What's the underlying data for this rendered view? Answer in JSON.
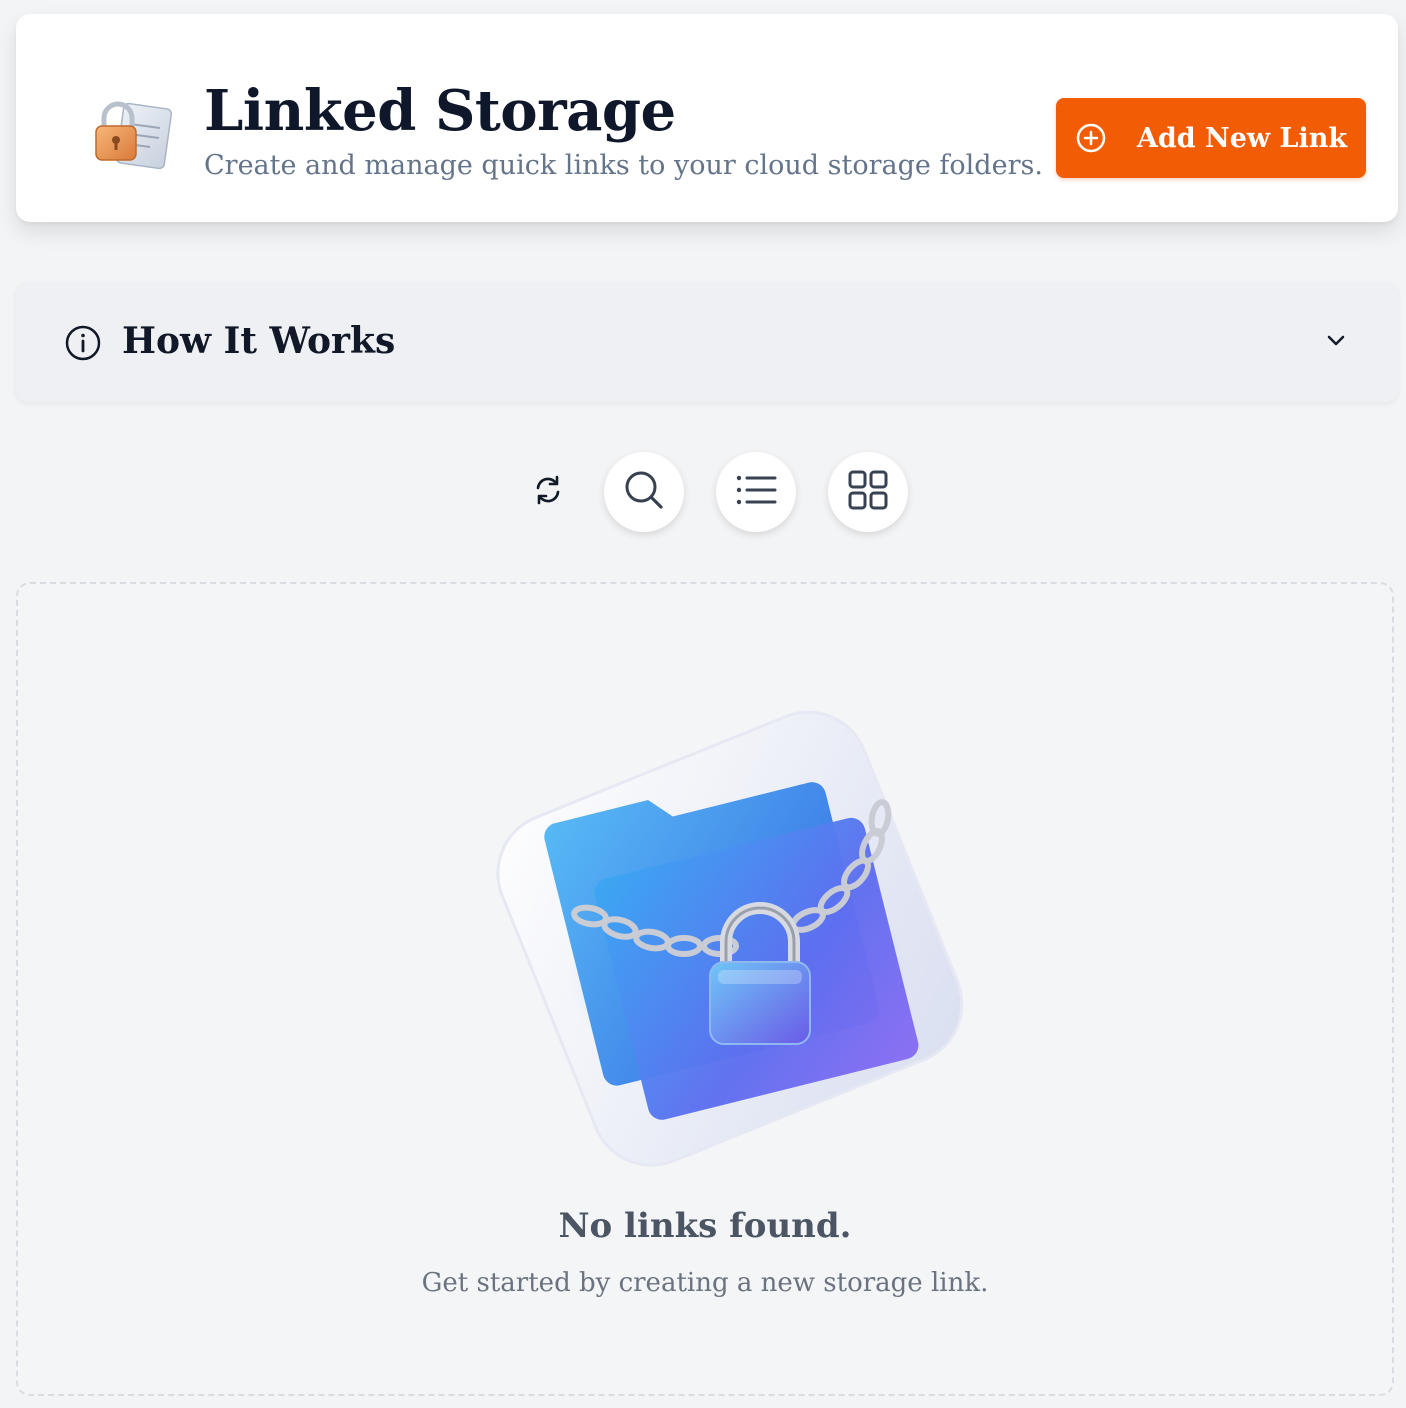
{
  "header": {
    "title": "Linked Storage",
    "subtitle": "Create and manage quick links to your cloud storage folders.",
    "logo_icon": "padlock-document-icon",
    "add_button_label": "Add New Link",
    "add_button_icon": "plus-circle-icon"
  },
  "how_it_works": {
    "title": "How It Works",
    "icon": "info-icon",
    "state": "collapsed"
  },
  "toolbar": {
    "buttons": [
      "refresh-icon",
      "search-icon",
      "list-view-icon",
      "grid-view-icon"
    ]
  },
  "empty_state": {
    "illustration": "locked-folder-chain-icon",
    "title": "No links found.",
    "subtitle": "Get started by creating a new storage link."
  },
  "colors": {
    "accent": "#f25c05",
    "background": "#f3f4f6",
    "card": "#ffffff",
    "text_primary": "#0f172a",
    "text_muted": "#64748b"
  }
}
